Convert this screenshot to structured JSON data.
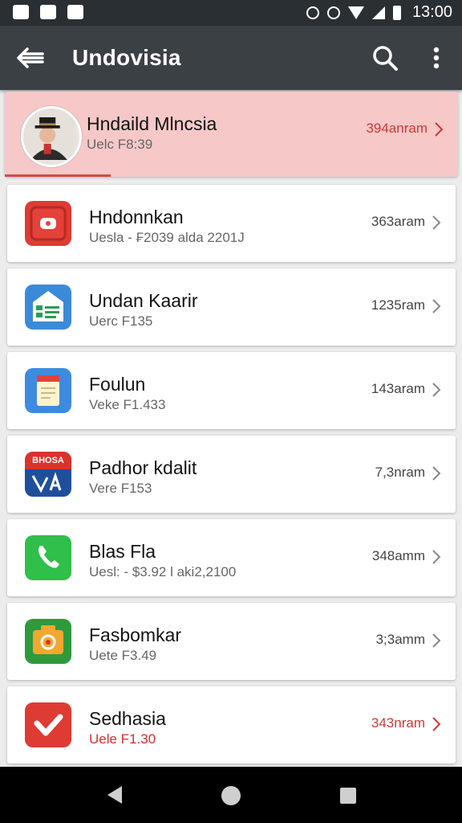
{
  "status_bar": {
    "time": "13:00",
    "icons": [
      "notification-icon",
      "notification-icon-2",
      "notification-icon-3",
      "alarm-icon",
      "location-icon",
      "wifi-icon",
      "signal-icon",
      "battery-icon"
    ]
  },
  "app_bar": {
    "title": "Undovisia",
    "back_icon": "back-arrow-icon",
    "search_icon": "search-icon",
    "more_icon": "more-vert-icon"
  },
  "items": [
    {
      "title": "Hndaild Mlncsia",
      "subtitle": "Uelc F8:39",
      "value": "394anram",
      "highlighted": true,
      "icon": "avatar",
      "value_color": "#c93a3a",
      "subtitle_color": "#666666"
    },
    {
      "title": "Hndonnkan",
      "subtitle": "Uesla - ₣2039 alda 2201J",
      "value": "363aram",
      "icon": "youtube-icon"
    },
    {
      "title": "Undan Kaarir",
      "subtitle": "Uerc F135",
      "value": "1235ram",
      "icon": "contacts-card-icon"
    },
    {
      "title": "Foulun",
      "subtitle": "Veke F1.433",
      "value": "143aram",
      "icon": "notes-icon"
    },
    {
      "title": "Padhor kdalit",
      "subtitle": "Vere F153",
      "value": "7,3nram",
      "icon": "bhosa-app-icon",
      "icon_text": "BHOSA"
    },
    {
      "title": "Blas Fla",
      "subtitle": "Uesl: - $3.92 l aki2,2100",
      "value": "348amm",
      "icon": "phone-icon"
    },
    {
      "title": "Fasbomkar",
      "subtitle": "Uete F3.49",
      "value": "3;3amm",
      "icon": "camera-app-icon"
    },
    {
      "title": "Sedhasia",
      "subtitle": "Uele F1.30",
      "value": "343nram",
      "icon": "heart-app-icon",
      "value_color": "#c93a3a",
      "subtitle_color": "#d42e2e"
    }
  ],
  "nav_bar": {
    "back": "nav-back-icon",
    "home": "nav-home-icon",
    "recents": "nav-recents-icon"
  },
  "colors": {
    "appbar": "#3b4045",
    "statusbar": "#2a2f33",
    "highlight": "#f6c8c8",
    "accent_red": "#d64a43",
    "list_bg": "#ececec"
  }
}
